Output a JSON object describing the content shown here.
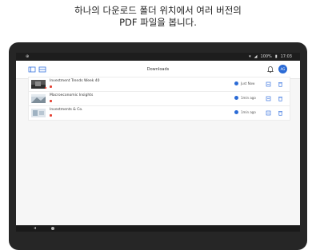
{
  "caption": {
    "line1": "하나의 다운로드 폴더 위치에서 여러 버전의",
    "line2": "PDF 파일을 봅니다."
  },
  "statusbar": {
    "left": "⊕",
    "battery": "100%",
    "time": "17:03"
  },
  "appbar": {
    "title": "Downloads",
    "avatar": "AG"
  },
  "files": [
    {
      "name": "Investment Trends Week 40",
      "status": "Just Now"
    },
    {
      "name": "Macroeconomic Insights",
      "status": "1min ago"
    },
    {
      "name": "Investments & Co.",
      "status": "1min ago"
    }
  ],
  "colors": {
    "accent": "#2b6bd6",
    "pdf": "#e54335",
    "device": "#262626"
  }
}
